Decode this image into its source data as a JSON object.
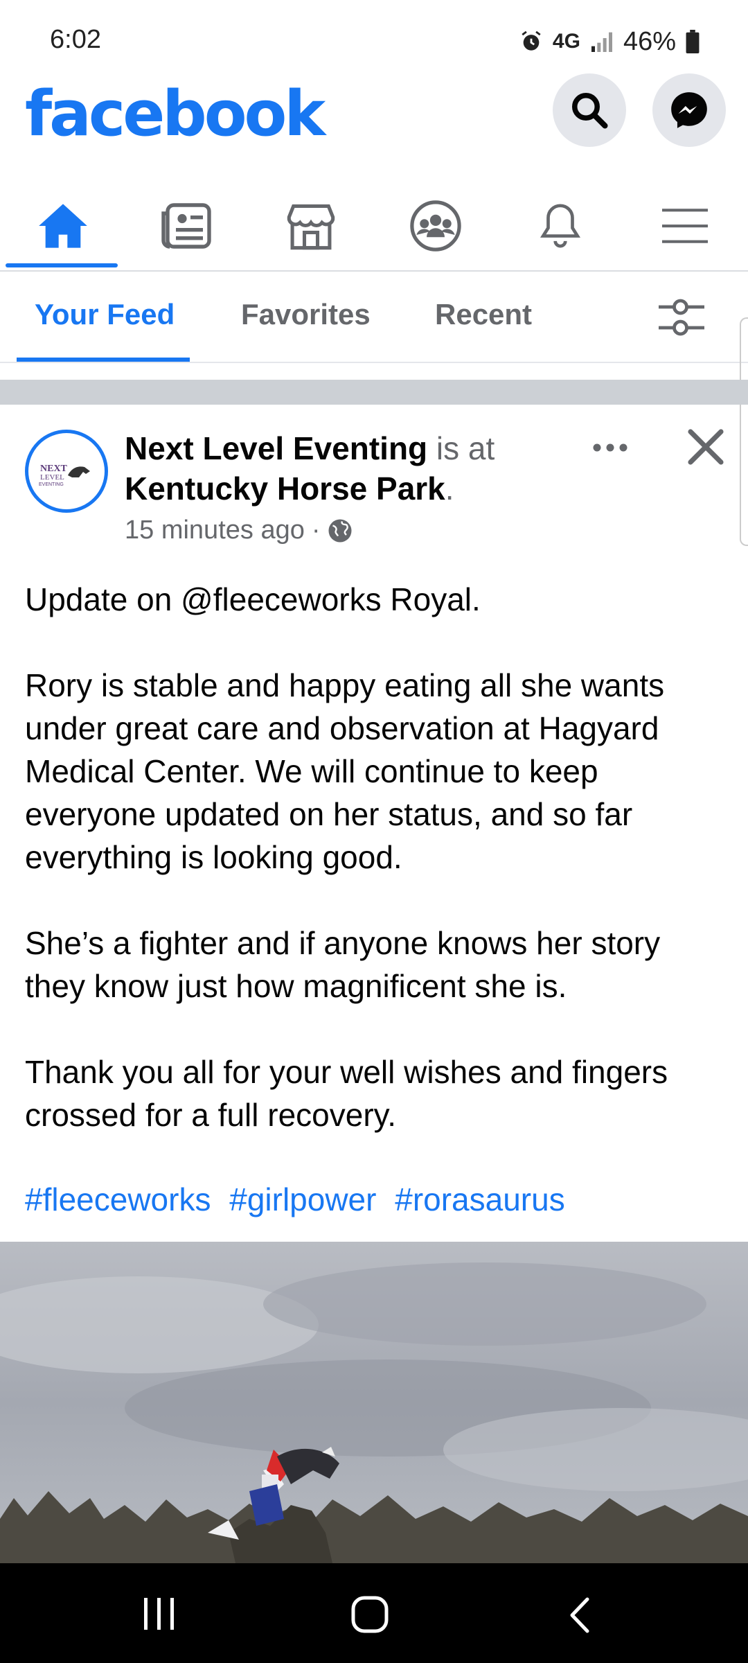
{
  "status_bar": {
    "time": "6:02",
    "network": "4G",
    "battery": "46%"
  },
  "header": {
    "logo": "facebook",
    "search_icon": "search-icon",
    "messenger_icon": "messenger-icon"
  },
  "nav": {
    "items": [
      "home-icon",
      "news-icon",
      "marketplace-icon",
      "groups-icon",
      "bell-icon",
      "menu-icon"
    ],
    "active": "home"
  },
  "feed_tabs": {
    "your_feed": "Your Feed",
    "favorites": "Favorites",
    "recent": "Recent"
  },
  "post": {
    "author": "Next Level Eventing",
    "is_at": "is at",
    "location": "Kentucky Horse Park",
    "location_suffix": ".",
    "time": "15 minutes ago",
    "time_sep": "·",
    "avatar_text": "NEXT LEVEL EVENTING",
    "body": "Update on @fleeceworks Royal.\n\nRory is stable and happy eating all she wants under great care and observation at Hagyard Medical Center. We will continue to keep everyone updated on her status, and so far everything is looking good.\n\nShe’s a fighter and if anyone knows her story they know just how magnificent she is.\n\nThank you all for your well wishes and fingers crossed for a full recovery.",
    "hashtags": [
      "#fleeceworks",
      "#girlpower",
      "#rorasaurus"
    ]
  },
  "colors": {
    "brand": "#1877f2",
    "secondary_text": "#65676b"
  }
}
